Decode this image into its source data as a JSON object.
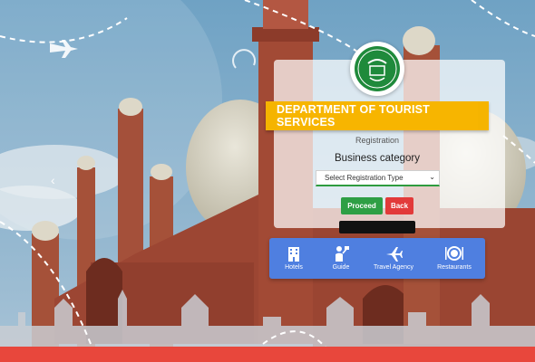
{
  "header": {
    "title": "DEPARTMENT OF TOURIST SERVICES"
  },
  "form": {
    "registration_label": "Registration",
    "category_label": "Business category",
    "select_value": "Select Registration Type",
    "proceed_label": "Proceed",
    "back_label": "Back"
  },
  "services": [
    {
      "label": "Hotels",
      "icon": "hotel-icon"
    },
    {
      "label": "Guide",
      "icon": "guide-icon"
    },
    {
      "label": "Travel Agency",
      "icon": "airplane-icon"
    },
    {
      "label": "Restaurants",
      "icon": "restaurant-icon"
    }
  ],
  "colors": {
    "ribbon": "#f7b500",
    "proceed": "#2e9f45",
    "back": "#e23a3a",
    "service_bar": "#4f7fe0",
    "footer": "#e8473c",
    "emblem_green": "#1f8a3b"
  }
}
